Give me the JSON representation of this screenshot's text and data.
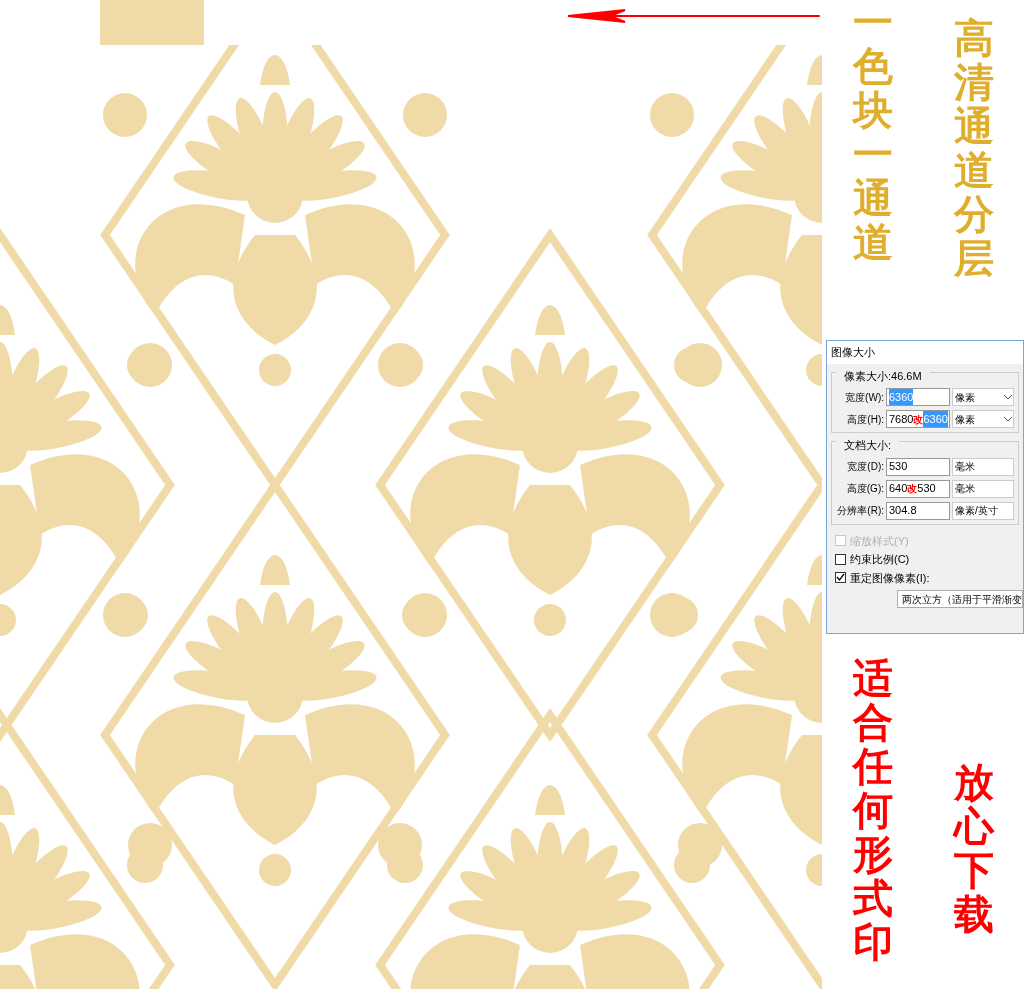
{
  "top_taglines": [
    {
      "text": "一色块一通道",
      "kind": "gold"
    },
    {
      "text": "高清通道分层",
      "kind": "gold"
    }
  ],
  "dialog": {
    "title": "图像大小",
    "groups": [
      {
        "legend": "像素大小:46.6M",
        "rows": [
          {
            "label": "宽度(W):",
            "parts": [
              {
                "text": "6360",
                "kind": "selected"
              }
            ],
            "unit": "像素",
            "chevron": true
          },
          {
            "label": "高度(H):",
            "parts": [
              {
                "text": "7680",
                "kind": "plain"
              },
              {
                "text": "改",
                "kind": "annotation"
              },
              {
                "text": "6360",
                "kind": "selected"
              }
            ],
            "unit": "像素",
            "chevron": true
          }
        ]
      },
      {
        "legend": "文档大小:",
        "rows": [
          {
            "label": "宽度(D):",
            "parts": [
              {
                "text": "530",
                "kind": "plain"
              }
            ],
            "unit": "毫米",
            "chevron": false
          },
          {
            "label": "高度(G):",
            "parts": [
              {
                "text": "640",
                "kind": "plain"
              },
              {
                "text": "改",
                "kind": "annotation"
              },
              {
                "text": "530",
                "kind": "plain"
              }
            ],
            "unit": "毫米",
            "chevron": false
          },
          {
            "label": "分辨率(R):",
            "parts": [
              {
                "text": "304.8",
                "kind": "plain"
              }
            ],
            "unit": "像素/英寸",
            "chevron": false
          }
        ]
      }
    ],
    "checkboxes": [
      {
        "label": "缩放样式(Y)",
        "checked": false,
        "disabled": true
      },
      {
        "label": "约束比例(C)",
        "checked": false,
        "disabled": false
      },
      {
        "label": "重定图像像素(I):",
        "checked": true,
        "disabled": false
      }
    ],
    "resample_method": "两次立方（适用于平滑渐变"
  },
  "bottom_taglines": [
    {
      "text": "适合任何形式印",
      "kind": "red"
    },
    {
      "text": "放心下载",
      "kind": "red"
    }
  ]
}
